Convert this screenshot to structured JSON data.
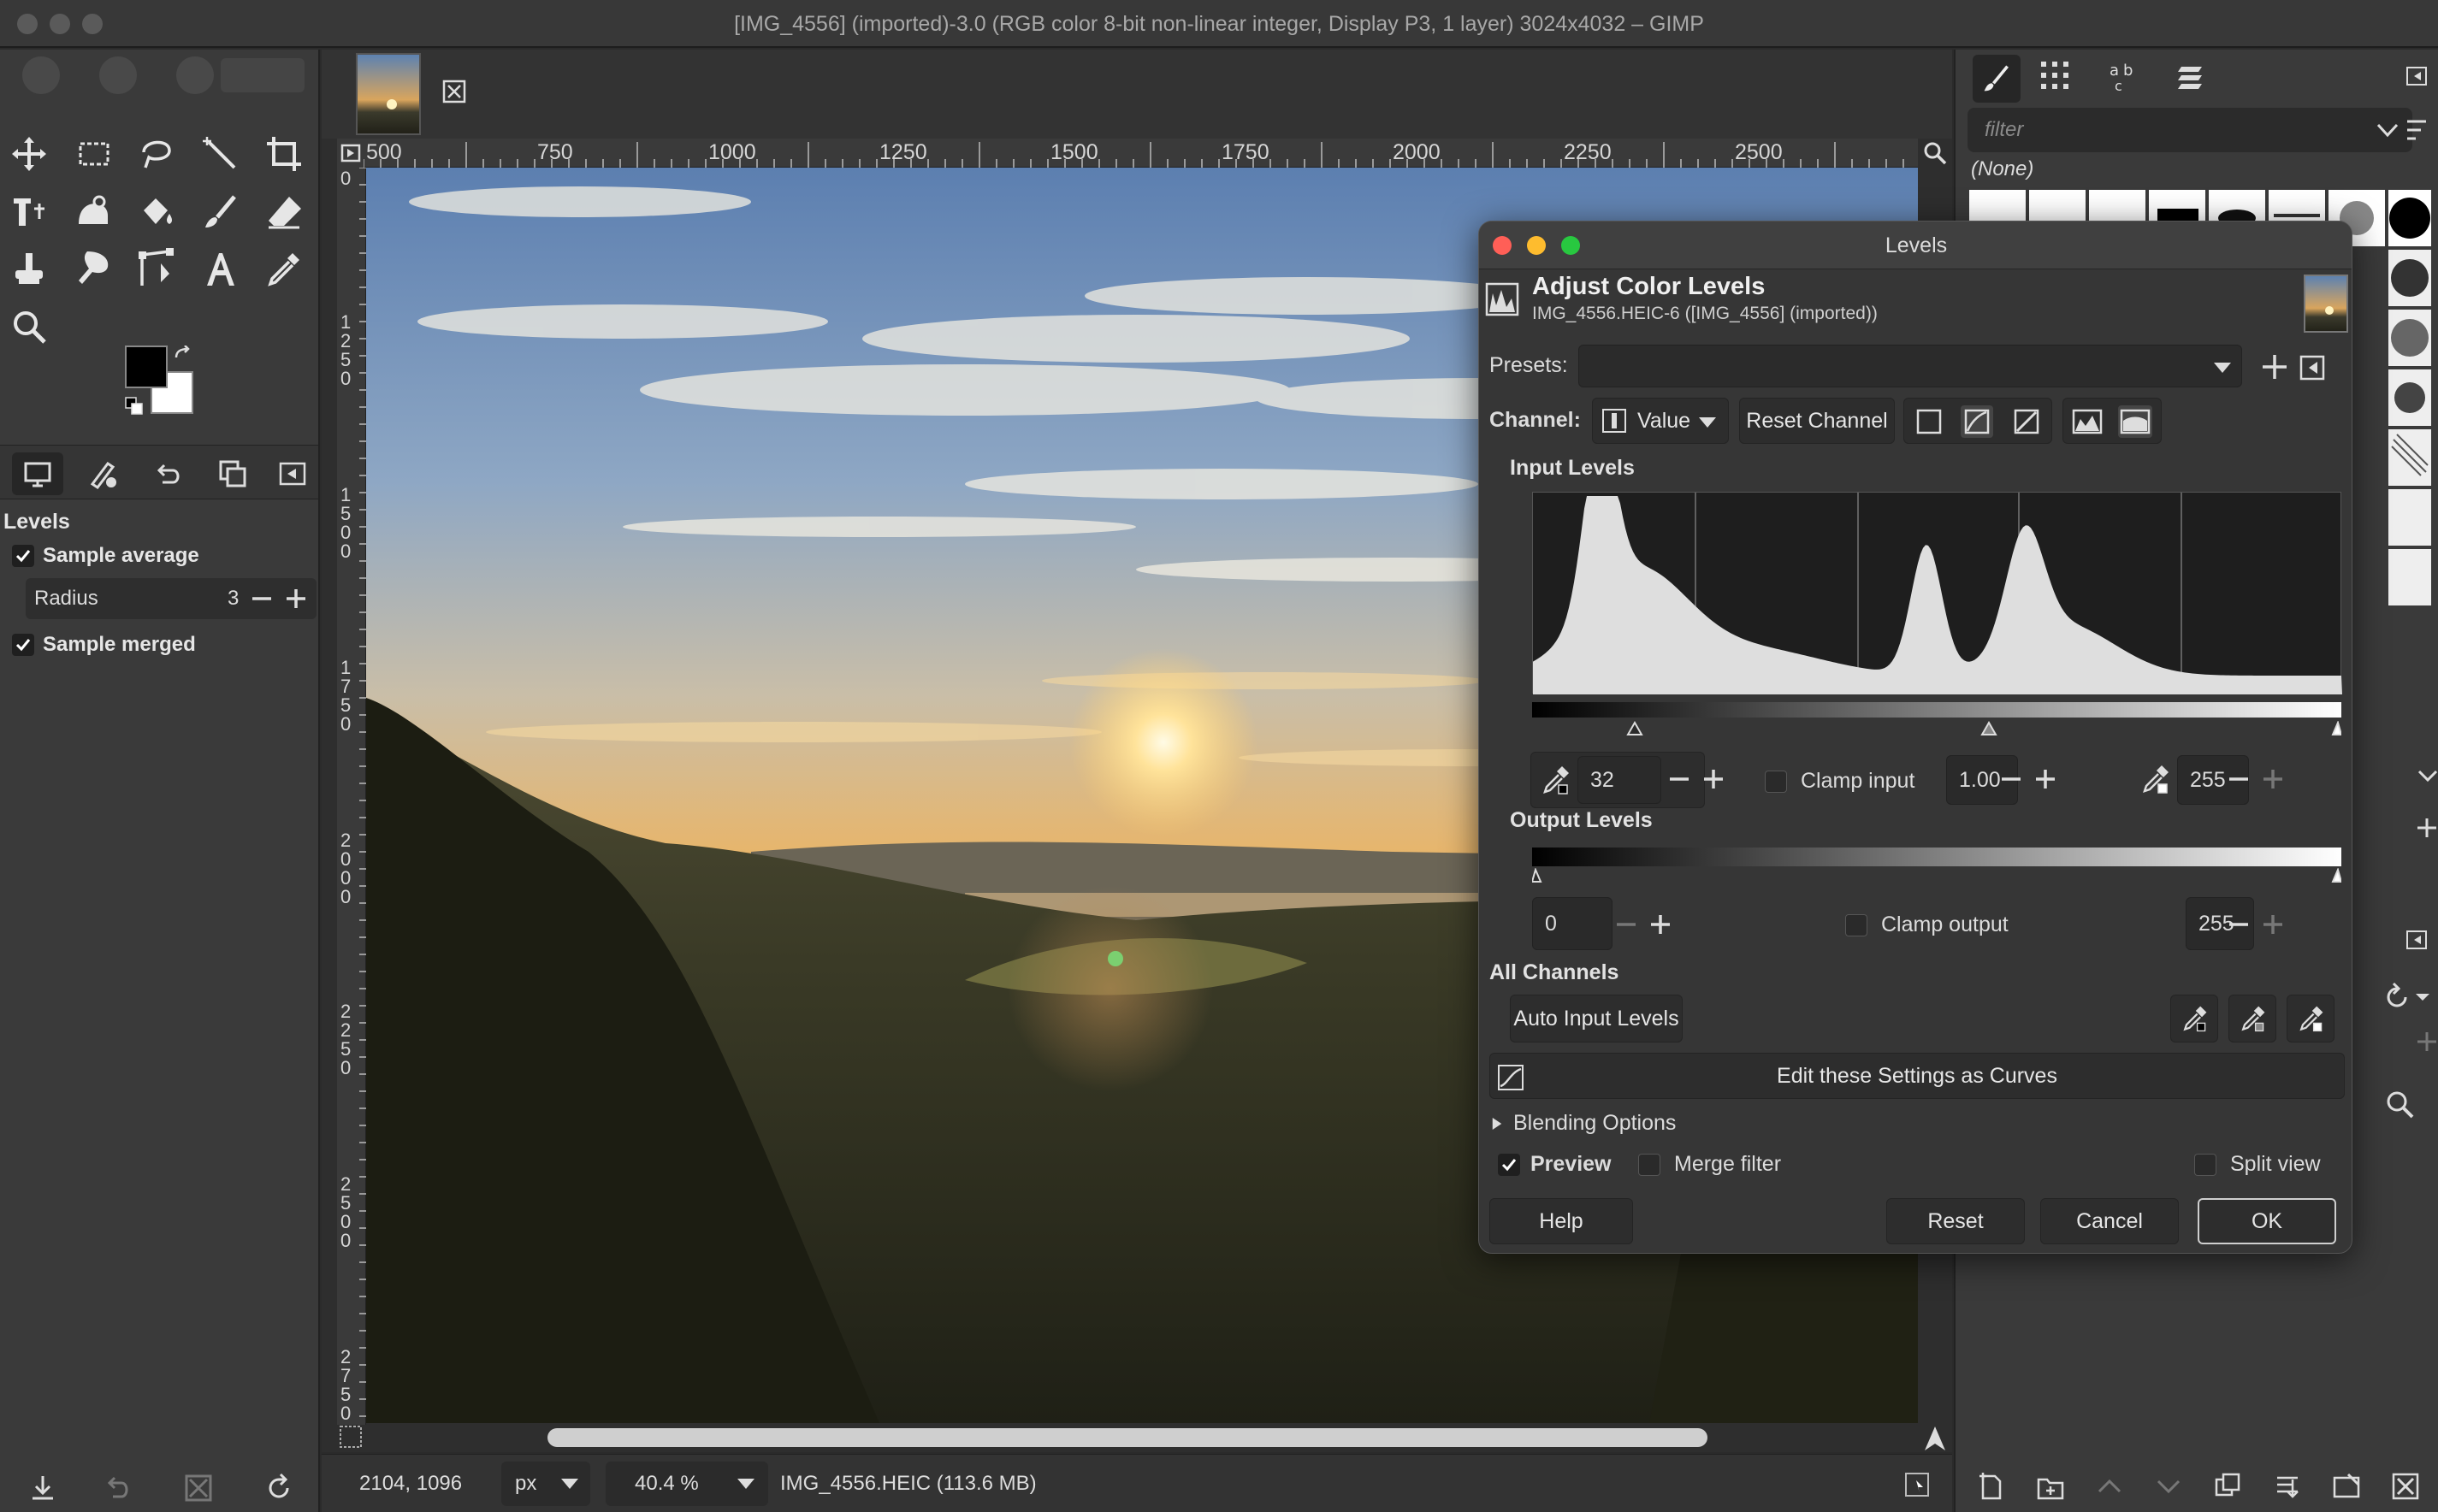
{
  "window": {
    "title": "[IMG_4556] (imported)-3.0 (RGB color 8-bit non-linear integer, Display P3, 1 layer) 3024x4032 – GIMP"
  },
  "colors": {
    "traffic_close": "#ff5f57",
    "traffic_min": "#febc2e",
    "traffic_max": "#28c840"
  },
  "toolbox": {
    "tools": [
      "move-tool-icon",
      "rect-select-icon",
      "free-select-icon",
      "fuzzy-select-icon",
      "crop-icon",
      "unified-transform-icon",
      "warp-icon",
      "bucket-fill-icon",
      "paintbrush-icon",
      "eraser-icon",
      "clone-icon",
      "smudge-icon",
      "paths-icon",
      "text-icon",
      "color-picker-icon",
      "zoom-icon"
    ],
    "options": {
      "title": "Levels",
      "sample_average_label": "Sample average",
      "radius_label": "Radius",
      "radius_value": "3",
      "sample_merged_label": "Sample merged"
    }
  },
  "ruler": {
    "h_labels": [
      "500",
      "750",
      "1000",
      "1250",
      "1500",
      "1750",
      "2000",
      "2250",
      "2500"
    ],
    "v_labels": [
      "0",
      "1250",
      "1500",
      "1750",
      "2000",
      "2250",
      "2500",
      "2750"
    ]
  },
  "statusbar": {
    "coords": "2104, 1096",
    "unit": "px",
    "zoom": "40.4 %",
    "file_info": "IMG_4556.HEIC (113.6 MB)"
  },
  "dock": {
    "filter_placeholder": "filter",
    "brush_none": "(None)"
  },
  "levels": {
    "window_title": "Levels",
    "heading": "Adjust Color Levels",
    "subheading": "IMG_4556.HEIC-6 ([IMG_4556] (imported))",
    "presets_label": "Presets:",
    "channel_label": "Channel:",
    "channel_value": "Value",
    "reset_channel_label": "Reset Channel",
    "input_levels_label": "Input Levels",
    "input_low": "32",
    "clamp_input_label": "Clamp input",
    "gamma": "1.00",
    "input_high": "255",
    "output_levels_label": "Output Levels",
    "output_low": "0",
    "clamp_output_label": "Clamp output",
    "output_high": "255",
    "all_channels_label": "All Channels",
    "auto_input_label": "Auto Input Levels",
    "edit_curves_label": "Edit these Settings as Curves",
    "blending_label": "Blending Options",
    "preview_label": "Preview",
    "merge_filter_label": "Merge filter",
    "split_view_label": "Split view",
    "help_label": "Help",
    "reset_label": "Reset",
    "cancel_label": "Cancel",
    "ok_label": "OK"
  }
}
